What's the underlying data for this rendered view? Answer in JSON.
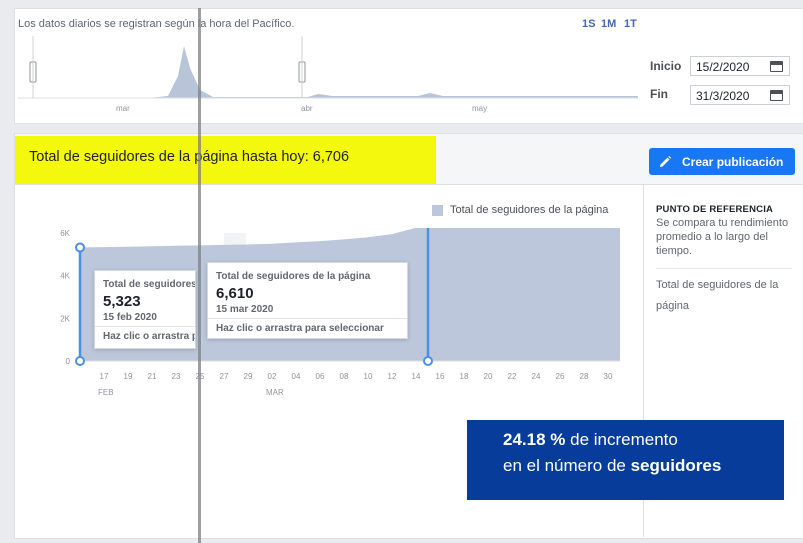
{
  "timeline": {
    "note": "Los datos diarios se registran según la hora del Pacífico.",
    "ranges": [
      "1S",
      "1M",
      "1T"
    ],
    "month_labels": [
      "mar",
      "abr",
      "may"
    ]
  },
  "dates": {
    "start_label": "Inicio",
    "start_value": "15/2/2020",
    "end_label": "Fin",
    "end_value": "31/3/2020"
  },
  "banner": {
    "text": "Total de seguidores de la página hasta hoy: 6,706"
  },
  "toolbar": {
    "create_label": "Crear publicación"
  },
  "legend": {
    "label": "Total de seguidores de la página",
    "color": "#bcc7db"
  },
  "benchmark": {
    "title": "PUNTO DE REFERENCIA",
    "desc": "Se compara tu rendimiento promedio a lo largo del tiempo.",
    "metric": "Total de seguidores de la página"
  },
  "tooltip_start": {
    "title": "Total de seguidores de la página",
    "value": "5,323",
    "date": "15 feb 2020",
    "cta": "Haz clic o arrastra para seleccionar"
  },
  "tooltip_end": {
    "title": "Total de seguidores de la página",
    "value": "6,610",
    "date": "15 mar 2020",
    "cta": "Haz clic o arrastra para seleccionar"
  },
  "stat": {
    "pct": "24.18 %",
    "line1_rest": " de incremento",
    "line2_pre": "en el número de ",
    "line2_bold": "seguidores"
  },
  "chart_data": {
    "type": "area",
    "x_tick_labels": [
      "17",
      "19",
      "21",
      "23",
      "25",
      "27",
      "29",
      "02",
      "04",
      "06",
      "08",
      "10",
      "12",
      "14",
      "16",
      "18",
      "20",
      "22",
      "24",
      "26",
      "28",
      "30"
    ],
    "x_month_labels": [
      "FEB",
      "MAR"
    ],
    "y_tick_labels": [
      "0",
      "2K",
      "4K",
      "6K"
    ],
    "ylim": [
      0,
      6000
    ],
    "series": [
      {
        "name": "Total de seguidores de la página",
        "x": [
          "15 feb",
          "17 feb",
          "19 feb",
          "21 feb",
          "23 feb",
          "25 feb",
          "27 feb",
          "29 feb",
          "2 mar",
          "4 mar",
          "6 mar",
          "8 mar",
          "10 mar",
          "12 mar",
          "14 mar",
          "15 mar",
          "16 mar",
          "18 mar",
          "20 mar",
          "22 mar",
          "24 mar",
          "26 mar",
          "28 mar",
          "30 mar",
          "31 mar"
        ],
        "values": [
          5323,
          5340,
          5360,
          5380,
          5400,
          5420,
          5440,
          5460,
          5500,
          5560,
          5620,
          5700,
          5800,
          5950,
          6250,
          6610,
          6640,
          6650,
          6660,
          6670,
          6680,
          6690,
          6700,
          6705,
          6706
        ]
      }
    ],
    "selection": {
      "start": "15 feb 2020",
      "end": "15 mar 2020"
    },
    "grid": false,
    "legend_position": "top-right"
  }
}
